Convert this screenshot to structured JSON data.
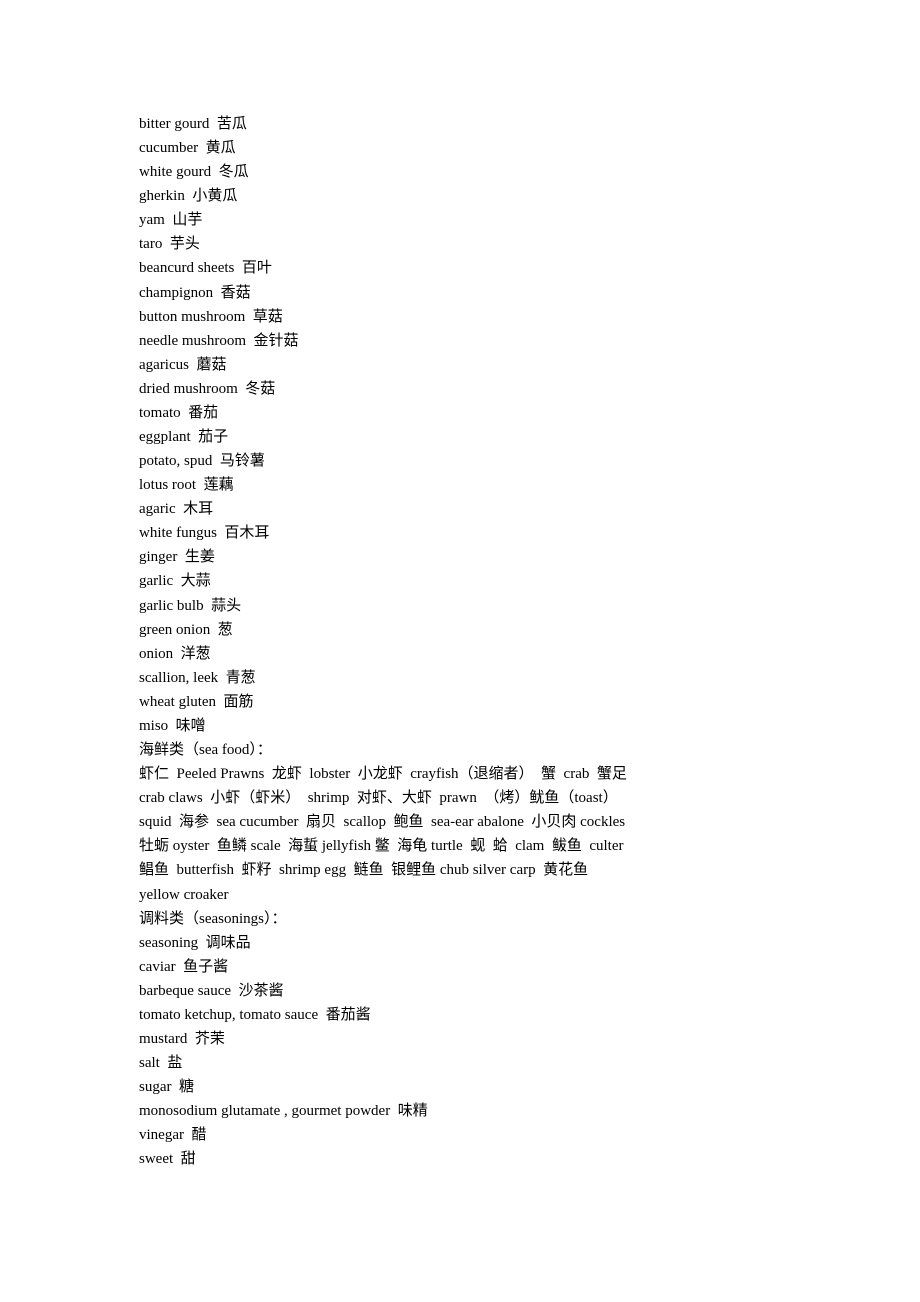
{
  "lines": [
    "bitter gourd  苦瓜",
    "cucumber  黄瓜",
    "white gourd  冬瓜",
    "gherkin  小黄瓜",
    "yam  山芋",
    "taro  芋头",
    "beancurd sheets  百叶",
    "champignon  香菇",
    "button mushroom  草菇",
    "needle mushroom  金针菇",
    "agaricus  蘑菇",
    "dried mushroom  冬菇",
    "tomato  番茄",
    "eggplant  茄子",
    "potato, spud  马铃薯",
    "lotus root  莲藕",
    "agaric  木耳",
    "white fungus  百木耳",
    "ginger  生姜",
    "garlic  大蒜",
    "garlic bulb  蒜头",
    "green onion  葱",
    "onion  洋葱",
    "scallion, leek  青葱",
    "wheat gluten  面筋",
    "miso  味噌",
    "海鲜类（sea food）：",
    "虾仁  Peeled Prawns  龙虾  lobster  小龙虾  crayfish（退缩者）  蟹  crab  蟹足",
    "crab claws  小虾（虾米）  shrimp  对虾、大虾  prawn  （烤）鱿鱼（toast）",
    "squid  海参  sea cucumber  扇贝  scallop  鲍鱼  sea-ear abalone  小贝肉 cockles",
    "牡蛎 oyster  鱼鳞 scale  海蜇 jellyfish 鳖  海龟 turtle  蚬  蛤  clam  鲅鱼  culter",
    "鲳鱼  butterfish  虾籽  shrimp egg  鲢鱼  银鲤鱼 chub silver carp  黄花鱼",
    "yellow croaker",
    "调料类（seasonings）：",
    "seasoning  调味品",
    "caviar  鱼子酱",
    "barbeque sauce  沙茶酱",
    "tomato ketchup, tomato sauce  番茄酱",
    "mustard  芥茉",
    "salt  盐",
    "sugar  糖",
    "monosodium glutamate , gourmet powder  味精",
    "vinegar  醋",
    "sweet  甜"
  ]
}
